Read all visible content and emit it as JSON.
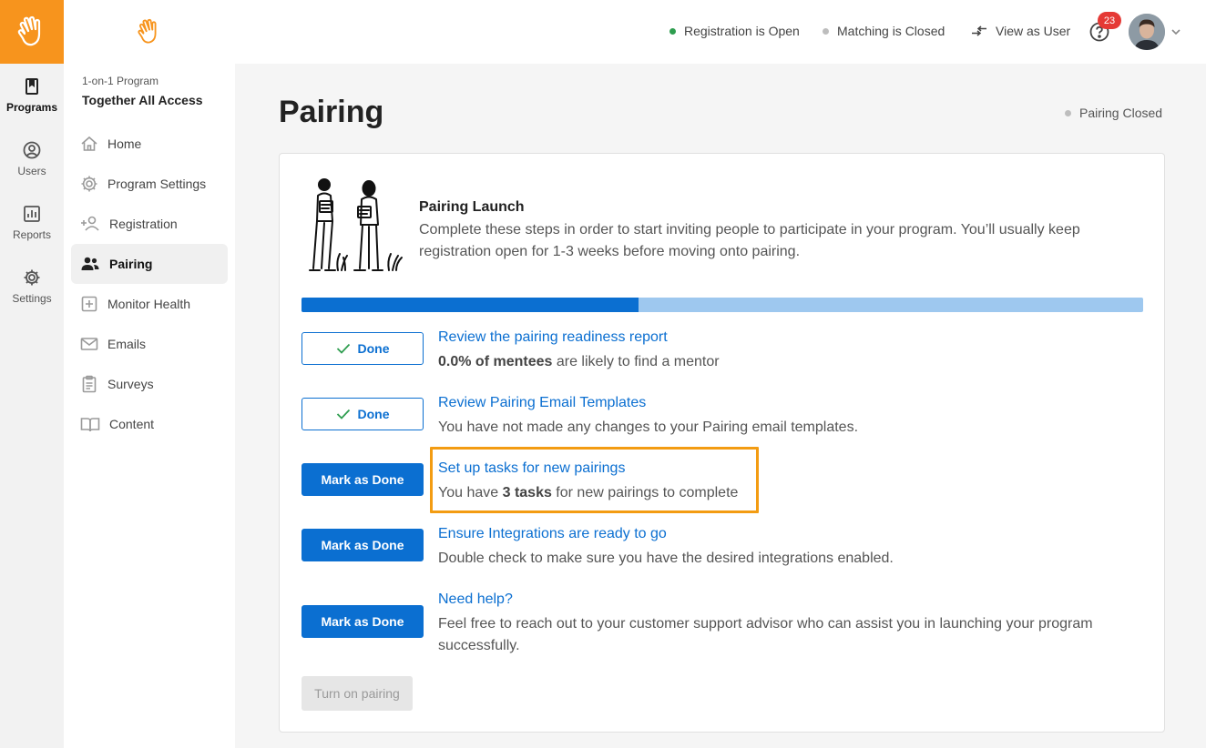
{
  "rail": {
    "items": [
      {
        "label": "Programs",
        "icon": "bookmark-icon"
      },
      {
        "label": "Users",
        "icon": "user-circle-icon"
      },
      {
        "label": "Reports",
        "icon": "bar-chart-icon"
      },
      {
        "label": "Settings",
        "icon": "gear-icon"
      }
    ]
  },
  "sidebar": {
    "program_kicker": "1-on-1 Program",
    "program_name": "Together All Access",
    "items": [
      {
        "label": "Home",
        "icon": "home-icon"
      },
      {
        "label": "Program Settings",
        "icon": "gear-icon"
      },
      {
        "label": "Registration",
        "icon": "add-user-icon"
      },
      {
        "label": "Pairing",
        "icon": "people-icon"
      },
      {
        "label": "Monitor Health",
        "icon": "health-cross-icon"
      },
      {
        "label": "Emails",
        "icon": "mail-icon"
      },
      {
        "label": "Surveys",
        "icon": "clipboard-icon"
      },
      {
        "label": "Content",
        "icon": "book-icon"
      }
    ]
  },
  "header": {
    "registration_status": "Registration is Open",
    "matching_status": "Matching is Closed",
    "view_as_user": "View as User",
    "notification_count": "23"
  },
  "page": {
    "title": "Pairing",
    "pairing_state": "Pairing Closed"
  },
  "launch": {
    "title": "Pairing Launch",
    "description": "Complete these steps in order to start inviting people to participate in your program. You’ll usually keep registration open for 1-3 weeks before moving onto pairing.",
    "progress_percent": 40
  },
  "steps": [
    {
      "button": "Done",
      "status": "done",
      "link": "Review the pairing readiness report",
      "text_bold": "0.0% of mentees",
      "text_after": " are likely to find a mentor"
    },
    {
      "button": "Done",
      "status": "done",
      "link": "Review Pairing Email Templates",
      "text": "You have not made any changes to your Pairing email templates."
    },
    {
      "button": "Mark as Done",
      "status": "todo",
      "link": "Set up tasks for new pairings",
      "text_before": "You have ",
      "text_bold": "3 tasks",
      "text_after": " for new pairings to complete"
    },
    {
      "button": "Mark as Done",
      "status": "todo",
      "link": "Ensure Integrations are ready to go",
      "text": "Double check to make sure you have the desired integrations enabled."
    },
    {
      "button": "Mark as Done",
      "status": "todo",
      "link": "Need help?",
      "text": "Feel free to reach out to your customer support advisor who can assist you in launching your program successfully."
    }
  ],
  "turn_on_button": "Turn on pairing",
  "colors": {
    "brand_orange": "#f7941d",
    "primary_blue": "#0b6fd1",
    "progress_track": "#9ec8ef",
    "open_green": "#2e9d4f",
    "closed_gray": "#bdbdbd",
    "highlight": "#f39c12",
    "badge_red": "#e53935"
  }
}
